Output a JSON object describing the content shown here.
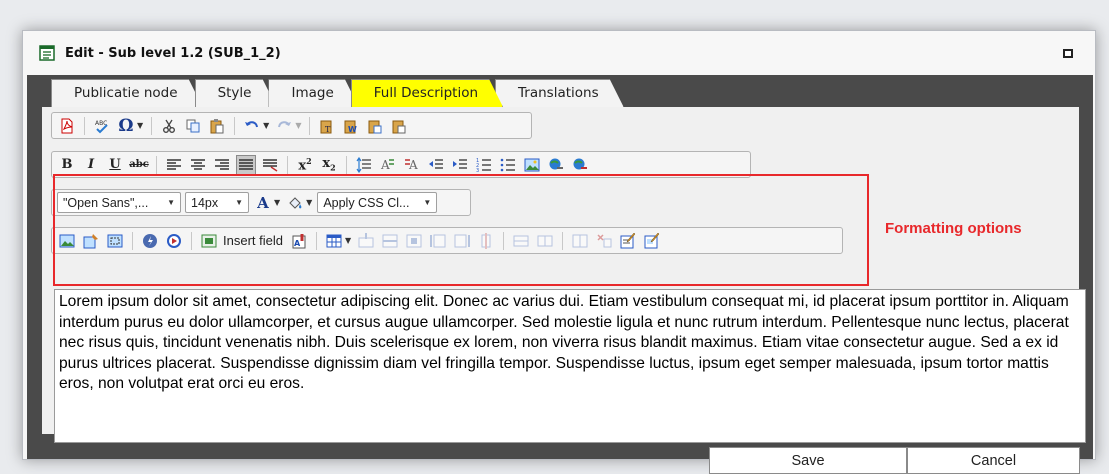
{
  "window": {
    "title": "Edit - Sub level 1.2 (SUB_1_2)",
    "title_icon": "form-icon",
    "maximize_icon": "maximize-icon"
  },
  "tabs": [
    {
      "label": "Publicatie node",
      "active": false
    },
    {
      "label": "Style",
      "active": false
    },
    {
      "label": "Image",
      "active": false
    },
    {
      "label": "Full Description",
      "active": true
    },
    {
      "label": "Translations",
      "active": false
    }
  ],
  "toolbar1": {
    "icons": [
      "pdf-icon",
      "spellcheck-icon",
      "omega-icon",
      "cut-icon",
      "copy-icon",
      "paste-icon",
      "undo-icon",
      "redo-icon",
      "paste-text-icon",
      "paste-word-icon",
      "paste-special-icon",
      "paste-plain-icon"
    ]
  },
  "toolbar2": {
    "bold": "B",
    "italic": "I",
    "underline": "U",
    "strike": "abc",
    "icons": [
      "align-left-icon",
      "align-center-icon",
      "align-right-icon",
      "justify-icon",
      "justify-full-icon",
      "superscript-icon",
      "subscript-icon",
      "line-height-icon",
      "text-direction-ltr-icon",
      "text-direction-rtl-icon",
      "outdent-icon",
      "indent-icon",
      "ordered-list-icon",
      "unordered-list-icon",
      "image-icon",
      "link-icon",
      "unlink-icon"
    ]
  },
  "toolbar3": {
    "font_family": "\"Open Sans\",...",
    "font_size": "14px",
    "font_color_label": "A",
    "css_class": "Apply CSS Cl..."
  },
  "toolbar4": {
    "insert_field": "Insert field",
    "icons": [
      "insert-image-icon",
      "image-properties-icon",
      "image-map-icon",
      "flash-icon",
      "media-icon",
      "insert-field-icon",
      "field-tag-icon",
      "table-icon",
      "row-insert-icon",
      "row-delete-icon",
      "cell-icon",
      "column-insert-before-icon",
      "column-insert-after-icon",
      "column-delete-icon",
      "merge-cells-icon",
      "split-cells-icon",
      "table-properties-icon",
      "cell-properties-icon",
      "edit-table-icon",
      "edit-cell-icon"
    ]
  },
  "annotation": "Formatting options",
  "annotation_color": "#e8282b",
  "content": {
    "text": "Lorem ipsum dolor sit amet, consectetur adipiscing elit. Donec ac varius dui. Etiam vestibulum consequat mi, id placerat ipsum porttitor in. Aliquam interdum purus eu dolor ullamcorper, et cursus augue ullamcorper. Sed molestie ligula et nunc rutrum interdum. Pellentesque nunc lectus, placerat nec risus quis, tincidunt venenatis nibh. Duis scelerisque ex lorem, non viverra risus blandit maximus. Etiam vitae consectetur augue. Sed a ex id purus ultrices placerat. Suspendisse dignissim diam vel fringilla tempor. Suspendisse luctus, ipsum eget semper malesuada, ipsum tortor mattis eros, non volutpat erat orci eu eros."
  },
  "footer": {
    "save": "Save",
    "cancel": "Cancel"
  },
  "colors": {
    "active_tab": "#ffff00",
    "panel": "#4a4a4a",
    "highlight": "#e8282b"
  }
}
